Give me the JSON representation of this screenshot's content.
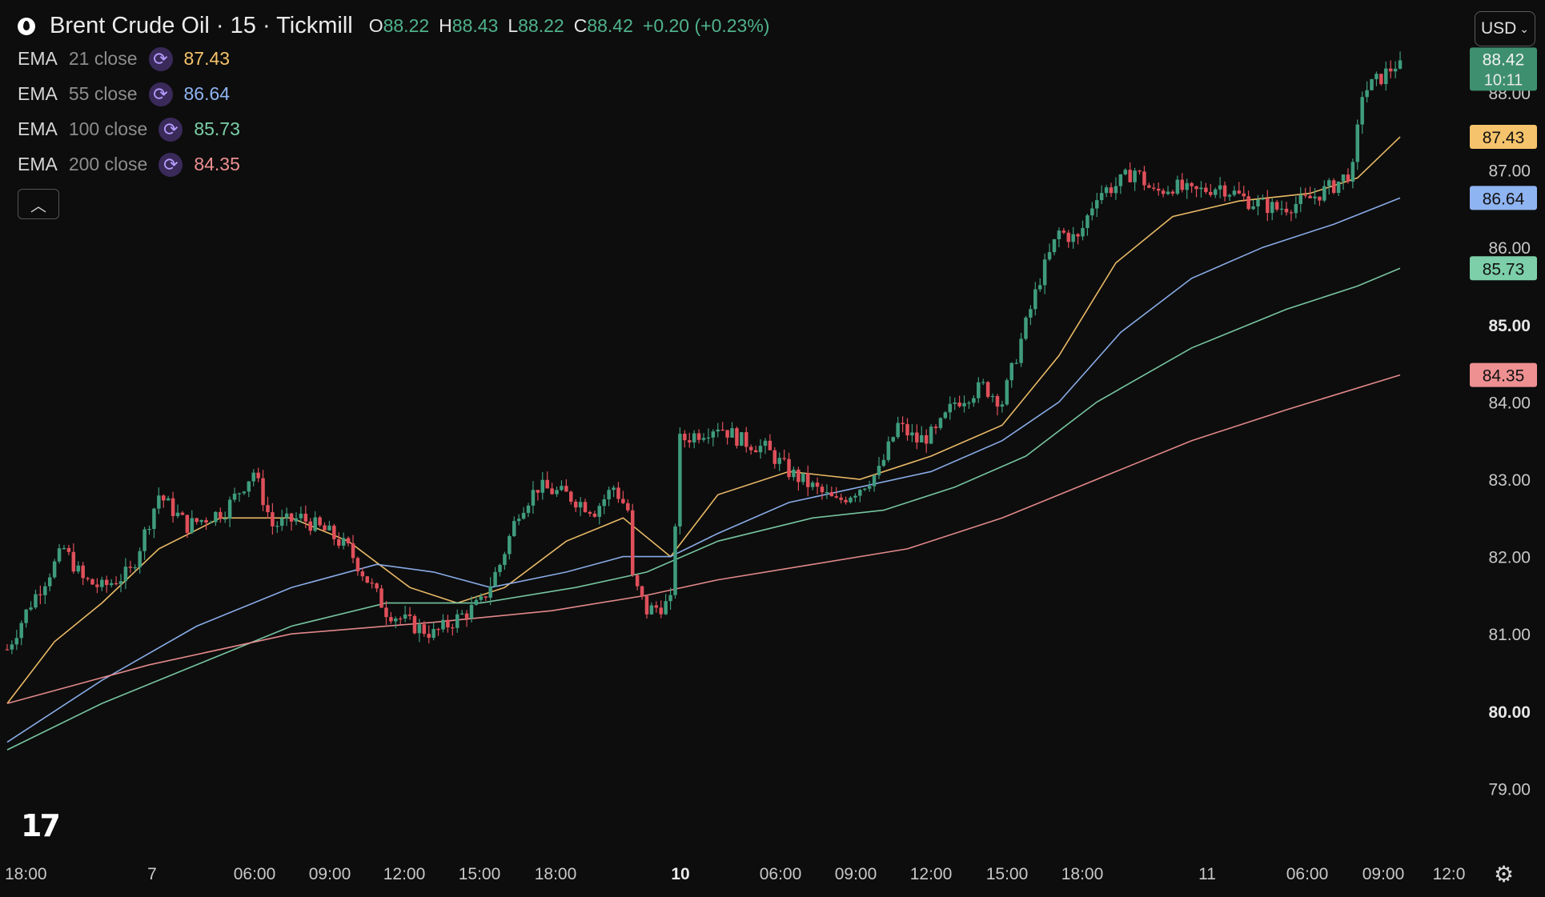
{
  "header": {
    "title": "Brent Crude Oil · 15 · Tickmill",
    "open_label": "O",
    "open_value": "88.22",
    "high_label": "H",
    "high_value": "88.43",
    "low_label": "L",
    "low_value": "88.22",
    "close_label": "C",
    "close_value": "88.42",
    "change": "+0.20 (+0.23%)"
  },
  "indicators": [
    {
      "name": "EMA",
      "params": "21 close",
      "value": "87.43",
      "color": "#f5c36b",
      "icon": "cycle-icon"
    },
    {
      "name": "EMA",
      "params": "55 close",
      "value": "86.64",
      "color": "#8fb4f2",
      "icon": "cycle-icon"
    },
    {
      "name": "EMA",
      "params": "100 close",
      "value": "85.73",
      "color": "#7ccfa9",
      "icon": "cycle-icon"
    },
    {
      "name": "EMA",
      "params": "200 close",
      "value": "84.35",
      "color": "#ee8f91",
      "icon": "cycle-icon"
    }
  ],
  "currency_button": "USD",
  "collapse_icon": "chevron-up-icon",
  "settings_icon": "gear-icon",
  "colors": {
    "up": "#3f9c7e",
    "down": "#e0505a",
    "background": "#0d0d0d",
    "last_price_tag": "#3d8f70"
  },
  "chart_data": {
    "type": "candlestick",
    "title": "Brent Crude Oil · 15 · Tickmill",
    "ylim": [
      78.6,
      89.2
    ],
    "y_ticks": [
      "79.00",
      "80.00",
      "81.00",
      "82.00",
      "83.00",
      "84.00",
      "85.00",
      "86.00",
      "87.00",
      "88.00"
    ],
    "y_ticks_bold": [
      "80.00",
      "85.00"
    ],
    "x_ticks": [
      "18:00",
      "7",
      "06:00",
      "09:00",
      "12:00",
      "15:00",
      "18:00",
      "10",
      "06:00",
      "09:00",
      "12:00",
      "15:00",
      "18:00",
      "11",
      "06:00",
      "09:00",
      "12:0"
    ],
    "x_ticks_bold": [
      "10"
    ],
    "last_price": {
      "value": "88.42",
      "countdown": "10:11"
    },
    "price_tags": [
      {
        "value": "87.43",
        "color": "#f5c36b"
      },
      {
        "value": "86.64",
        "color": "#8fb4f2"
      },
      {
        "value": "85.73",
        "color": "#7ccfa9"
      },
      {
        "value": "84.35",
        "color": "#ee8f91"
      }
    ],
    "path_keypoints": [
      [
        0,
        80.8
      ],
      [
        5,
        81.4
      ],
      [
        12,
        82.1
      ],
      [
        16,
        81.7
      ],
      [
        20,
        81.6
      ],
      [
        26,
        81.8
      ],
      [
        32,
        82.8
      ],
      [
        38,
        82.4
      ],
      [
        46,
        82.6
      ],
      [
        52,
        83.1
      ],
      [
        56,
        82.4
      ],
      [
        62,
        82.5
      ],
      [
        68,
        82.3
      ],
      [
        72,
        82.1
      ],
      [
        76,
        81.7
      ],
      [
        80,
        81.3
      ],
      [
        86,
        81.1
      ],
      [
        90,
        81.0
      ],
      [
        95,
        81.2
      ],
      [
        100,
        81.4
      ],
      [
        104,
        81.9
      ],
      [
        108,
        82.6
      ],
      [
        112,
        82.9
      ],
      [
        118,
        82.8
      ],
      [
        124,
        82.6
      ],
      [
        128,
        82.9
      ],
      [
        131,
        82.6
      ],
      [
        132,
        81.7
      ],
      [
        135,
        81.3
      ],
      [
        140,
        81.4
      ],
      [
        142,
        83.5
      ],
      [
        146,
        83.6
      ],
      [
        150,
        83.7
      ],
      [
        155,
        83.5
      ],
      [
        160,
        83.4
      ],
      [
        165,
        83.1
      ],
      [
        170,
        82.9
      ],
      [
        175,
        82.7
      ],
      [
        180,
        82.9
      ],
      [
        184,
        83.1
      ],
      [
        188,
        83.7
      ],
      [
        192,
        83.5
      ],
      [
        196,
        83.6
      ],
      [
        200,
        84.0
      ],
      [
        206,
        84.2
      ],
      [
        210,
        84.0
      ],
      [
        214,
        84.8
      ],
      [
        218,
        85.6
      ],
      [
        222,
        86.2
      ],
      [
        226,
        86.1
      ],
      [
        230,
        86.7
      ],
      [
        234,
        86.8
      ],
      [
        238,
        87.0
      ],
      [
        242,
        86.7
      ],
      [
        246,
        86.8
      ],
      [
        250,
        86.7
      ],
      [
        256,
        86.8
      ],
      [
        262,
        86.6
      ],
      [
        268,
        86.5
      ],
      [
        274,
        86.6
      ],
      [
        280,
        86.8
      ],
      [
        284,
        87.0
      ],
      [
        286,
        88.0
      ],
      [
        290,
        88.2
      ],
      [
        294,
        88.42
      ]
    ],
    "series": [
      {
        "name": "EMA 21 close",
        "color": "#f5c36b",
        "points": [
          [
            0,
            80.1
          ],
          [
            10,
            80.9
          ],
          [
            20,
            81.4
          ],
          [
            32,
            82.1
          ],
          [
            45,
            82.5
          ],
          [
            60,
            82.5
          ],
          [
            72,
            82.2
          ],
          [
            85,
            81.6
          ],
          [
            95,
            81.4
          ],
          [
            105,
            81.6
          ],
          [
            118,
            82.2
          ],
          [
            130,
            82.5
          ],
          [
            140,
            82.0
          ],
          [
            150,
            82.8
          ],
          [
            165,
            83.1
          ],
          [
            180,
            83.0
          ],
          [
            195,
            83.3
          ],
          [
            210,
            83.7
          ],
          [
            222,
            84.6
          ],
          [
            234,
            85.8
          ],
          [
            246,
            86.4
          ],
          [
            260,
            86.6
          ],
          [
            275,
            86.7
          ],
          [
            285,
            86.9
          ],
          [
            294,
            87.43
          ]
        ]
      },
      {
        "name": "EMA 55 close",
        "color": "#8fb4f2",
        "points": [
          [
            0,
            79.6
          ],
          [
            20,
            80.4
          ],
          [
            40,
            81.1
          ],
          [
            60,
            81.6
          ],
          [
            78,
            81.9
          ],
          [
            90,
            81.8
          ],
          [
            102,
            81.6
          ],
          [
            118,
            81.8
          ],
          [
            130,
            82.0
          ],
          [
            140,
            82.0
          ],
          [
            150,
            82.3
          ],
          [
            165,
            82.7
          ],
          [
            180,
            82.9
          ],
          [
            195,
            83.1
          ],
          [
            210,
            83.5
          ],
          [
            222,
            84.0
          ],
          [
            235,
            84.9
          ],
          [
            250,
            85.6
          ],
          [
            265,
            86.0
          ],
          [
            280,
            86.3
          ],
          [
            294,
            86.64
          ]
        ]
      },
      {
        "name": "EMA 100 close",
        "color": "#7ccfa9",
        "points": [
          [
            0,
            79.5
          ],
          [
            20,
            80.1
          ],
          [
            40,
            80.6
          ],
          [
            60,
            81.1
          ],
          [
            80,
            81.4
          ],
          [
            100,
            81.4
          ],
          [
            120,
            81.6
          ],
          [
            135,
            81.8
          ],
          [
            150,
            82.2
          ],
          [
            170,
            82.5
          ],
          [
            185,
            82.6
          ],
          [
            200,
            82.9
          ],
          [
            215,
            83.3
          ],
          [
            230,
            84.0
          ],
          [
            250,
            84.7
          ],
          [
            270,
            85.2
          ],
          [
            285,
            85.5
          ],
          [
            294,
            85.73
          ]
        ]
      },
      {
        "name": "EMA 200 close",
        "color": "#ee8f91",
        "points": [
          [
            0,
            80.1
          ],
          [
            30,
            80.6
          ],
          [
            60,
            81.0
          ],
          [
            90,
            81.15
          ],
          [
            115,
            81.3
          ],
          [
            135,
            81.5
          ],
          [
            150,
            81.7
          ],
          [
            170,
            81.9
          ],
          [
            190,
            82.1
          ],
          [
            210,
            82.5
          ],
          [
            230,
            83.0
          ],
          [
            250,
            83.5
          ],
          [
            270,
            83.9
          ],
          [
            294,
            84.35
          ]
        ]
      }
    ],
    "grid": false,
    "legend": "top-left"
  }
}
